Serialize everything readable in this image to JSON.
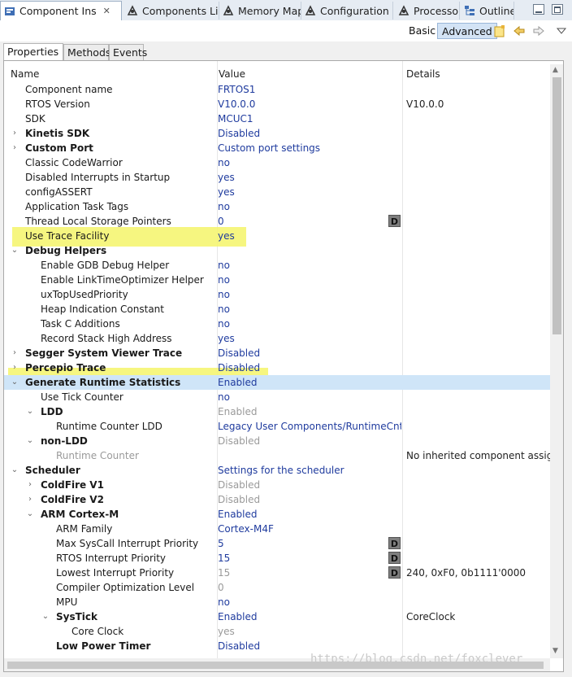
{
  "tabs": [
    {
      "label": "Component Ins",
      "icon": "component-inspector-icon",
      "close": "✕",
      "active": true
    },
    {
      "label": "Components Lib",
      "icon": "components-library-icon"
    },
    {
      "label": "Memory Map",
      "icon": "memory-map-icon"
    },
    {
      "label": "Configuration R",
      "icon": "configuration-registers-icon"
    },
    {
      "label": "Processor",
      "icon": "processor-icon"
    },
    {
      "label": "Outline",
      "icon": "outline-icon"
    }
  ],
  "toolbar": {
    "basic": "Basic",
    "advanced": "Advanced"
  },
  "subtabs": [
    "Properties",
    "Methods",
    "Events"
  ],
  "headers": {
    "name": "Name",
    "value": "Value",
    "details": "Details"
  },
  "rows": [
    {
      "name": "Component name",
      "value": "FRTOS1"
    },
    {
      "name": "RTOS Version",
      "value": "V10.0.0",
      "details": "V10.0.0"
    },
    {
      "name": "SDK",
      "value": "MCUC1"
    },
    {
      "name": "Kinetis SDK",
      "value": "Disabled",
      "bold": true,
      "toggle": "collapsed"
    },
    {
      "name": "Custom Port",
      "value": "Custom port settings",
      "bold": true,
      "toggle": "collapsed"
    },
    {
      "name": "Classic CodeWarrior",
      "value": "no"
    },
    {
      "name": "Disabled Interrupts in Startup",
      "value": "yes"
    },
    {
      "name": "configASSERT",
      "value": "yes"
    },
    {
      "name": "Application Task Tags",
      "value": "no"
    },
    {
      "name": "Thread Local Storage Pointers",
      "value": "0",
      "dbtn": "D"
    },
    {
      "name": "Use Trace Facility",
      "value": "yes"
    },
    {
      "name": "Debug Helpers",
      "value": "",
      "bold": true,
      "toggle": "expanded"
    },
    {
      "name": "Enable GDB Debug Helper",
      "value": "no",
      "level": 1
    },
    {
      "name": "Enable LinkTimeOptimizer Helper",
      "value": "no",
      "level": 1
    },
    {
      "name": "uxTopUsedPriority",
      "value": "no",
      "level": 1
    },
    {
      "name": "Heap Indication Constant",
      "value": "no",
      "level": 1
    },
    {
      "name": "Task C Additions",
      "value": "no",
      "level": 1
    },
    {
      "name": "Record Stack High Address",
      "value": "yes",
      "level": 1
    },
    {
      "name": "Segger System Viewer Trace",
      "value": "Disabled",
      "bold": true,
      "toggle": "collapsed"
    },
    {
      "name": "Percepio Trace",
      "value": "Disabled",
      "bold": true,
      "toggle": "collapsed"
    },
    {
      "name": "Generate Runtime Statistics",
      "value": "Enabled",
      "bold": true,
      "toggle": "expanded",
      "selected": true
    },
    {
      "name": "Use Tick Counter",
      "value": "no",
      "level": 1
    },
    {
      "name": "LDD",
      "value": "Enabled",
      "bold": true,
      "toggle": "expanded",
      "level": 1,
      "gval": true
    },
    {
      "name": "Runtime Counter LDD",
      "value": "Legacy User Components/RuntimeCntrLDD",
      "level": 2
    },
    {
      "name": "non-LDD",
      "value": "Disabled",
      "bold": true,
      "toggle": "expanded",
      "level": 1,
      "gval": true
    },
    {
      "name": "Runtime Counter",
      "value": "",
      "level": 2,
      "gname": true,
      "details": "No inherited component assigned"
    },
    {
      "name": "Scheduler",
      "value": "Settings for the scheduler",
      "bold": true,
      "toggle": "expanded"
    },
    {
      "name": "ColdFire V1",
      "value": "Disabled",
      "bold": true,
      "toggle": "collapsed",
      "level": 1,
      "gval": true
    },
    {
      "name": "ColdFire V2",
      "value": "Disabled",
      "bold": true,
      "toggle": "collapsed",
      "level": 1,
      "gval": true
    },
    {
      "name": "ARM Cortex-M",
      "value": "Enabled",
      "bold": true,
      "toggle": "expanded",
      "level": 1
    },
    {
      "name": "ARM Family",
      "value": "Cortex-M4F",
      "level": 2
    },
    {
      "name": "Max SysCall Interrupt Priority",
      "value": "5",
      "level": 2,
      "dbtn": "D"
    },
    {
      "name": "RTOS Interrupt Priority",
      "value": "15",
      "level": 2,
      "dbtn": "D"
    },
    {
      "name": "Lowest Interrupt Priority",
      "value": "15",
      "level": 2,
      "dbtn": "D",
      "gval": true,
      "details": "240, 0xF0, 0b1111'0000"
    },
    {
      "name": "Compiler Optimization Level",
      "value": "0",
      "level": 2,
      "gval": true
    },
    {
      "name": "MPU",
      "value": "no",
      "level": 2
    },
    {
      "name": "SysTick",
      "value": "Enabled",
      "bold": true,
      "toggle": "expanded",
      "level": 2,
      "details": "CoreClock"
    },
    {
      "name": "Core Clock",
      "value": "yes",
      "level": 3,
      "gval": true
    },
    {
      "name": "Low Power Timer",
      "value": "Disabled",
      "bold": true,
      "level": 2
    }
  ],
  "watermark": "https://blog.csdn.net/foxclever"
}
